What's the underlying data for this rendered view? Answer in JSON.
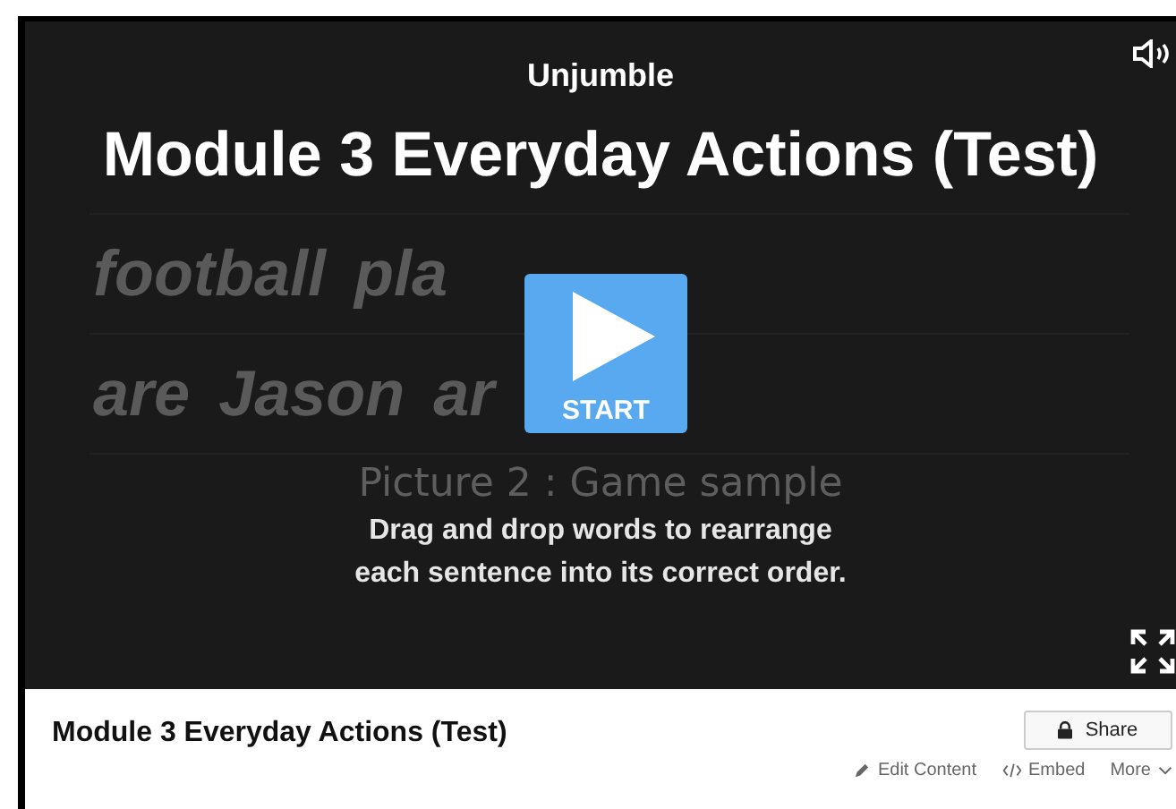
{
  "game": {
    "type_label": "Unjumble",
    "title": "Module 3 Everyday Actions (Test)",
    "background_rows": [
      {
        "words": [
          "football",
          "pla"
        ]
      },
      {
        "words": [
          "are",
          "Jason",
          "ar"
        ]
      }
    ],
    "background_caption": "Picture 2 : Game sample",
    "start_button": "START",
    "instructions": [
      "Drag and drop words to rearrange",
      "each sentence into its correct order."
    ]
  },
  "info": {
    "title": "Module 3 Everyday Actions (Test)",
    "share_button": "Share",
    "actions": [
      {
        "kind": "edit",
        "label": "Edit Content"
      },
      {
        "kind": "embed",
        "label": "Embed"
      },
      {
        "kind": "more",
        "label": "More"
      }
    ]
  }
}
